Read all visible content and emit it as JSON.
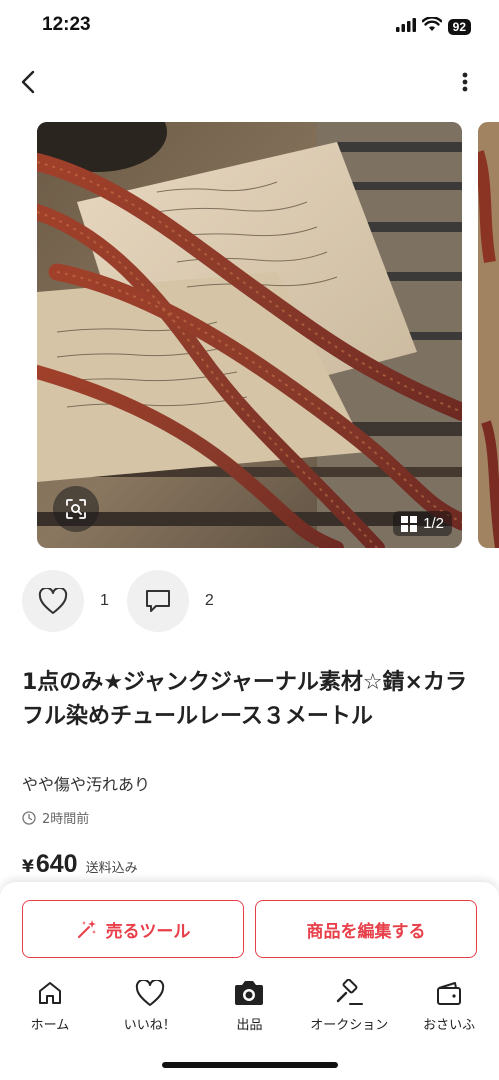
{
  "status_bar": {
    "time": "12:23",
    "battery": "92"
  },
  "gallery": {
    "counter": "1/2"
  },
  "reactions": {
    "likes": "1",
    "comments": "2"
  },
  "item": {
    "title": "1点のみ★ジャンクジャーナル素材☆錆×カラフル染めチュールレース３メートル",
    "condition": "やや傷や汚れあり",
    "posted": "2時間前",
    "price_symbol": "¥",
    "price": "640",
    "shipping_note": "送料込み"
  },
  "actions": {
    "sell_tool": "売るツール",
    "edit_item": "商品を編集する"
  },
  "tabs": [
    {
      "label": "ホーム",
      "icon": "home-icon"
    },
    {
      "label": "いいね！",
      "icon": "heart-icon"
    },
    {
      "label": "出品",
      "icon": "camera-icon"
    },
    {
      "label": "オークション",
      "icon": "gavel-icon"
    },
    {
      "label": "おさいふ",
      "icon": "wallet-icon"
    }
  ],
  "colors": {
    "accent": "#e8404a",
    "text": "#222222"
  }
}
